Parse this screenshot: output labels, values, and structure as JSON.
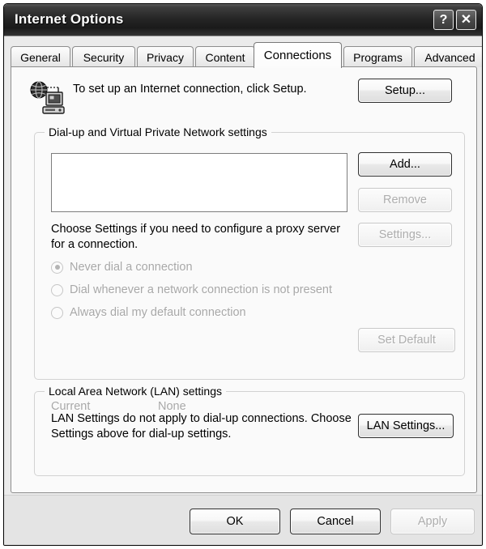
{
  "window": {
    "title": "Internet Options",
    "help_button": "?",
    "close_button": "✕"
  },
  "tabs": [
    {
      "label": "General",
      "active": false
    },
    {
      "label": "Security",
      "active": false
    },
    {
      "label": "Privacy",
      "active": false
    },
    {
      "label": "Content",
      "active": false
    },
    {
      "label": "Connections",
      "active": true
    },
    {
      "label": "Programs",
      "active": false
    },
    {
      "label": "Advanced",
      "active": false
    }
  ],
  "intro": {
    "text": "To set up an Internet connection, click Setup.",
    "icon": "globe-computer-icon",
    "setup_button": "Setup..."
  },
  "dialup_group": {
    "legend": "Dial-up and Virtual Private Network settings",
    "list_items": [],
    "add_button": "Add...",
    "remove_button": "Remove",
    "settings_button": "Settings...",
    "hint": "Choose Settings if you need to configure a proxy server for a connection.",
    "radios": [
      {
        "label": "Never dial a connection",
        "checked": true,
        "disabled": true
      },
      {
        "label": "Dial whenever a network connection is not present",
        "checked": false,
        "disabled": true
      },
      {
        "label": "Always dial my default connection",
        "checked": false,
        "disabled": true
      }
    ],
    "current_label": "Current",
    "current_value": "None",
    "set_default_button": "Set Default"
  },
  "lan_group": {
    "legend": "Local Area Network (LAN) settings",
    "text": "LAN Settings do not apply to dial-up connections. Choose Settings above for dial-up settings.",
    "lan_settings_button": "LAN Settings..."
  },
  "footer": {
    "ok_button": "OK",
    "cancel_button": "Cancel",
    "apply_button": "Apply"
  },
  "colors": {
    "titlebar": "#262626",
    "dialog_bg": "#ebebeb",
    "panel_bg": "#fafafa",
    "footer_bg": "#e4e4e4",
    "disabled_text": "#a8a8a8",
    "group_border": "#d2d2d2"
  }
}
